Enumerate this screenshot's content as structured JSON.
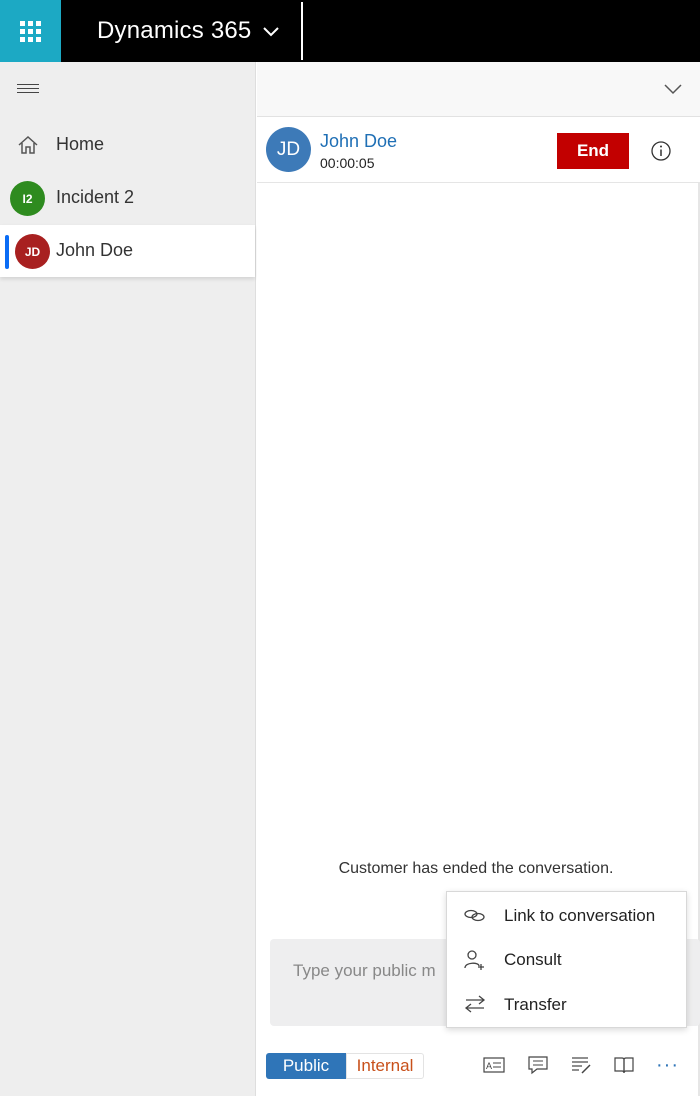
{
  "app": {
    "title": "Dynamics 365",
    "accent_color": "#1ca9c4",
    "waffle_icon": "app-launcher-icon",
    "title_chevron_icon": "chevron-down-icon"
  },
  "sidebar": {
    "menu_icon": "hamburger-icon",
    "items": [
      {
        "label": "Home",
        "icon": "home-icon"
      },
      {
        "label": "Incident 2",
        "initials": "I2",
        "color": "#2e8b1f"
      },
      {
        "label": "John Doe",
        "initials": "JD",
        "color": "#a82020",
        "active": true
      }
    ]
  },
  "conversation": {
    "collapse_icon": "chevron-down-icon",
    "customer": {
      "initials": "JD",
      "name": "John Doe",
      "timer": "00:00:05",
      "avatar_color": "#3d7ab8"
    },
    "end_label": "End",
    "end_color": "#c20000",
    "info_icon": "info-icon",
    "status_message": "Customer has ended the conversation.",
    "composer": {
      "placeholder": "Type your public m"
    }
  },
  "context_menu": {
    "items": [
      {
        "label": "Link to conversation",
        "icon": "link-icon"
      },
      {
        "label": "Consult",
        "icon": "add-person-icon"
      },
      {
        "label": "Transfer",
        "icon": "transfer-arrows-icon"
      }
    ]
  },
  "toolbar": {
    "public_label": "Public",
    "internal_label": "Internal",
    "icons": [
      "contact-card-icon",
      "quick-reply-icon",
      "notes-icon",
      "knowledge-base-icon"
    ],
    "more_label": "···"
  }
}
